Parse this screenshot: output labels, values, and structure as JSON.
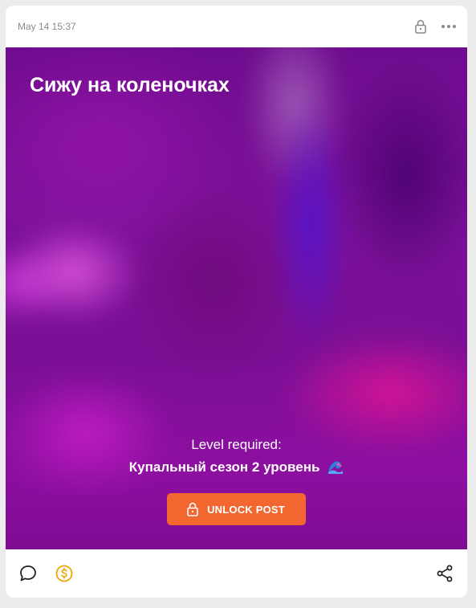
{
  "post": {
    "timestamp": "May 14 15:37",
    "title": "Сижу на коленочках",
    "level_label": "Level required:",
    "level_name": "Купальный сезон 2 уровень",
    "unlock_label": "UNLOCK POST"
  },
  "icons": {
    "header": [
      "lock-icon",
      "more-dots-icon"
    ],
    "level": "wave-emoji-icon",
    "unlock": "lock-icon",
    "footer": [
      "comment-icon",
      "dollar-coin-icon",
      "share-icon"
    ]
  },
  "colors": {
    "accent": "#f2662f",
    "coin": "#f0a500",
    "media_tint": "#7a0e9a",
    "page_bg": "#ececec"
  }
}
